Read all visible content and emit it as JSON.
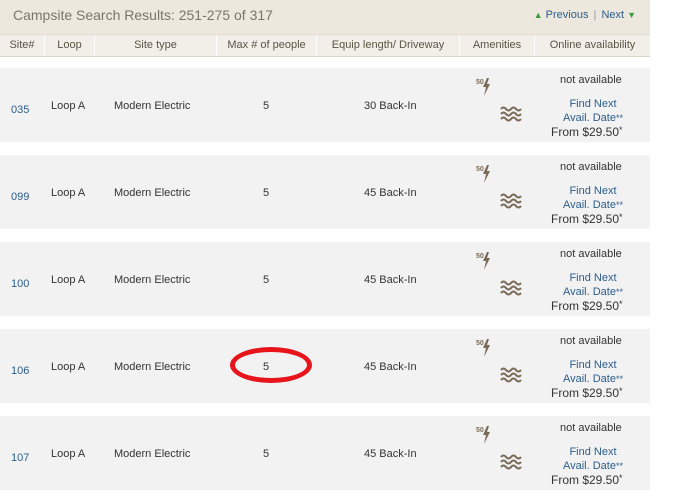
{
  "header": {
    "title": "Campsite Search Results: 251-275 of 317",
    "previous_label": "Previous",
    "separator": "|",
    "next_label": "Next",
    "previous_icon": "triangle-up-icon",
    "next_icon": "triangle-down-icon"
  },
  "columns": [
    "Site#",
    "Loop",
    "Site type",
    "Max # of people",
    "Equip length/ Driveway",
    "Amenities",
    "Online availability"
  ],
  "amenity_icons": {
    "electric": "electric-50amp-icon",
    "water": "waterfront-icon"
  },
  "rows": [
    {
      "site": "035",
      "loop": "Loop A",
      "type": "Modern Electric",
      "max": "5",
      "equip": "30 Back-In",
      "availability": "not available",
      "link_line1": "Find Next",
      "link_line2": "Avail. Date",
      "link_ast": "**",
      "price": "From $29.50",
      "price_ast": "*"
    },
    {
      "site": "099",
      "loop": "Loop A",
      "type": "Modern Electric",
      "max": "5",
      "equip": "45 Back-In",
      "availability": "not available",
      "link_line1": "Find Next",
      "link_line2": "Avail. Date",
      "link_ast": "**",
      "price": "From $29.50",
      "price_ast": "*"
    },
    {
      "site": "100",
      "loop": "Loop A",
      "type": "Modern Electric",
      "max": "5",
      "equip": "45 Back-In",
      "availability": "not available",
      "link_line1": "Find Next",
      "link_line2": "Avail. Date",
      "link_ast": "**",
      "price": "From $29.50",
      "price_ast": "*"
    },
    {
      "site": "106",
      "loop": "Loop A",
      "type": "Modern Electric",
      "max": "5",
      "equip": "45 Back-In",
      "availability": "not available",
      "link_line1": "Find Next",
      "link_line2": "Avail. Date",
      "link_ast": "**",
      "price": "From $29.50",
      "price_ast": "*"
    },
    {
      "site": "107",
      "loop": "Loop A",
      "type": "Modern Electric",
      "max": "5",
      "equip": "45 Back-In",
      "availability": "not available",
      "link_line1": "Find Next",
      "link_line2": "Avail. Date",
      "link_ast": "**",
      "price": "From $29.50",
      "price_ast": "*"
    }
  ],
  "electric_label": "50",
  "colors": {
    "link": "#2b5d8c",
    "nav_arrow": "#3d9a3d",
    "annotation": "#e8141b",
    "row_bg": "#f2f2f2",
    "header_bg": "#ece8de"
  }
}
